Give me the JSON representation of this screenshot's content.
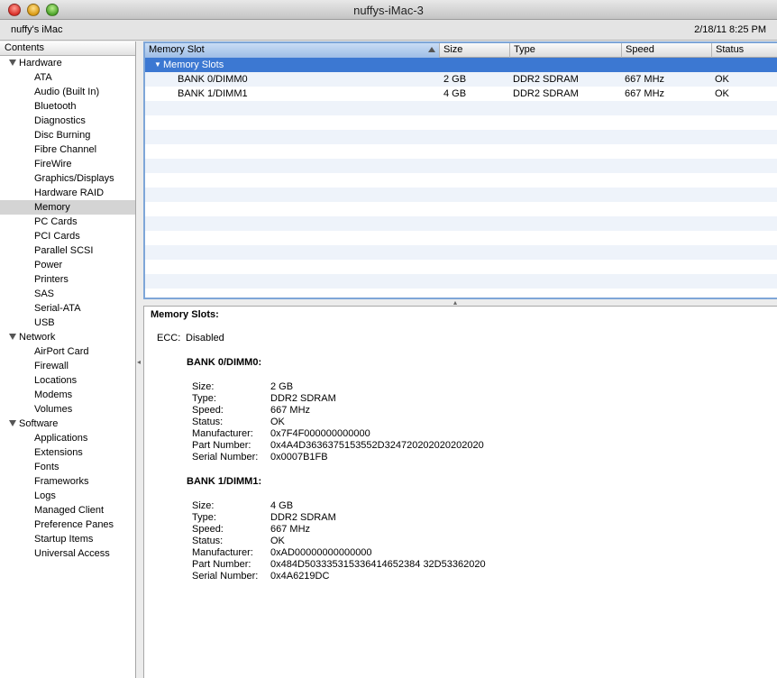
{
  "window": {
    "title": "nuffys-iMac-3"
  },
  "infobar": {
    "machine": "nuffy's iMac",
    "datetime": "2/18/11 8:25 PM"
  },
  "sidebar": {
    "header": "Contents",
    "hardware": {
      "label": "Hardware",
      "items": [
        "ATA",
        "Audio (Built In)",
        "Bluetooth",
        "Diagnostics",
        "Disc Burning",
        "Fibre Channel",
        "FireWire",
        "Graphics/Displays",
        "Hardware RAID",
        "Memory",
        "PC Cards",
        "PCI Cards",
        "Parallel SCSI",
        "Power",
        "Printers",
        "SAS",
        "Serial-ATA",
        "USB"
      ]
    },
    "network": {
      "label": "Network",
      "items": [
        "AirPort Card",
        "Firewall",
        "Locations",
        "Modems",
        "Volumes"
      ]
    },
    "software": {
      "label": "Software",
      "items": [
        "Applications",
        "Extensions",
        "Fonts",
        "Frameworks",
        "Logs",
        "Managed Client",
        "Preference Panes",
        "Startup Items",
        "Universal Access"
      ]
    }
  },
  "table": {
    "columns": [
      "Memory Slot",
      "Size",
      "Type",
      "Speed",
      "Status"
    ],
    "group": "Memory Slots",
    "rows": [
      {
        "slot": "BANK 0/DIMM0",
        "size": "2 GB",
        "type": "DDR2 SDRAM",
        "speed": "667 MHz",
        "status": "OK"
      },
      {
        "slot": "BANK 1/DIMM1",
        "size": "4 GB",
        "type": "DDR2 SDRAM",
        "speed": "667 MHz",
        "status": "OK"
      }
    ]
  },
  "detail": {
    "title": "Memory Slots:",
    "ecc_label": "ECC:",
    "ecc_value": "Disabled",
    "banks": [
      {
        "name": "BANK 0/DIMM0:",
        "fields": [
          {
            "label": "Size:",
            "value": "2 GB"
          },
          {
            "label": "Type:",
            "value": "DDR2 SDRAM"
          },
          {
            "label": "Speed:",
            "value": "667 MHz"
          },
          {
            "label": "Status:",
            "value": "OK"
          },
          {
            "label": "Manufacturer:",
            "value": "0x7F4F000000000000"
          },
          {
            "label": "Part Number:",
            "value": "0x4A4D3636375153552D324720202020202020"
          },
          {
            "label": "Serial Number:",
            "value": "0x0007B1FB"
          }
        ]
      },
      {
        "name": "BANK 1/DIMM1:",
        "fields": [
          {
            "label": "Size:",
            "value": "4 GB"
          },
          {
            "label": "Type:",
            "value": "DDR2 SDRAM"
          },
          {
            "label": "Speed:",
            "value": "667 MHz"
          },
          {
            "label": "Status:",
            "value": "OK"
          },
          {
            "label": "Manufacturer:",
            "value": "0xAD00000000000000"
          },
          {
            "label": "Part Number:",
            "value": "0x484D503335315336414652384 32D53362020"
          },
          {
            "label": "Serial Number:",
            "value": "0x4A6219DC"
          }
        ]
      }
    ]
  },
  "colors": {
    "selection": "#3c78d2",
    "focus_ring": "#7ea6d8",
    "stripe": "#eef3fa"
  }
}
